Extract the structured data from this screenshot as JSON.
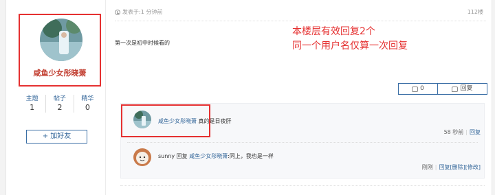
{
  "user": {
    "name": "咸鱼少女彤晓萧",
    "stats": [
      {
        "label": "主题",
        "value": "1"
      },
      {
        "label": "帖子",
        "value": "2"
      },
      {
        "label": "精华",
        "value": "0"
      }
    ],
    "add_friend_label": "+ 加好友"
  },
  "post": {
    "posted_prefix": "发表于:",
    "posted_time": "1 分钟前",
    "floor": "112楼",
    "content": "第一次是初中时候看的",
    "like_count": "0",
    "reply_label": "回复"
  },
  "annotation": {
    "line1": "本楼层有效回复2个",
    "line2": "同一个用户名仅算一次回复"
  },
  "replies": [
    {
      "user": "咸鱼少女彤晓萧",
      "text": "真的是日夜肝",
      "time": "58 秒前",
      "actions": [
        "回复"
      ]
    },
    {
      "user": "sunny",
      "verb": "回复",
      "target": "咸鱼少女彤晓萧",
      "text": ":同上，我也是一样",
      "time": "刚刚",
      "actions": [
        "回复",
        "[删除]",
        "[修改]"
      ]
    }
  ],
  "colors": {
    "highlight": "#e53030",
    "link": "#336699"
  }
}
